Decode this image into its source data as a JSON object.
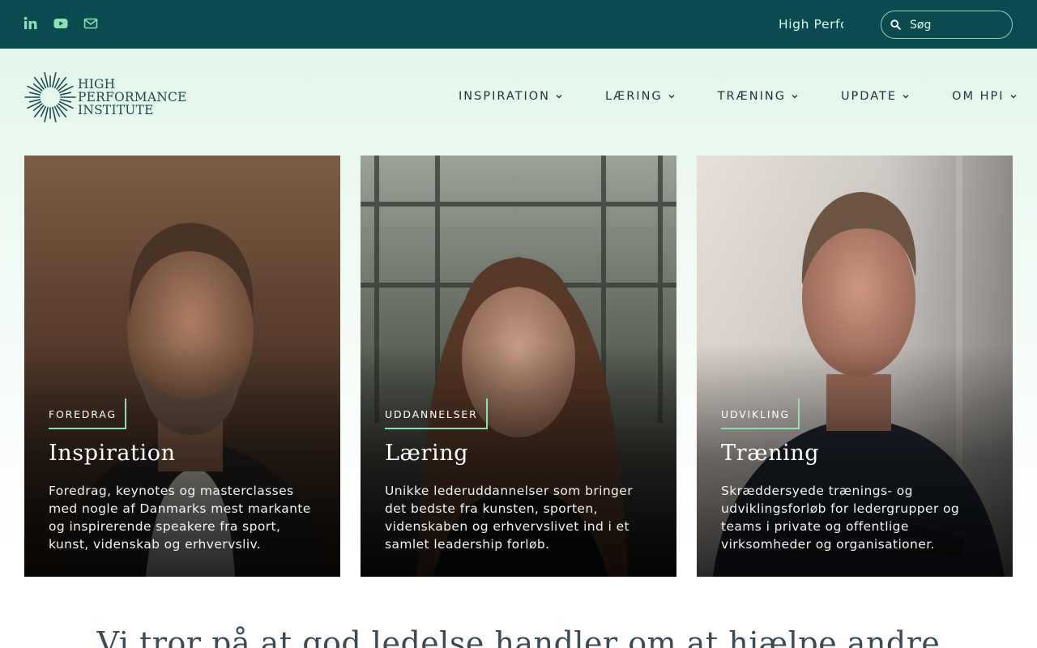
{
  "topbar": {
    "social": [
      {
        "icon": "linkedin-icon"
      },
      {
        "icon": "youtube-icon"
      },
      {
        "icon": "mail-icon"
      }
    ],
    "ticker_text": "High Perfo",
    "search": {
      "placeholder": "Søg"
    },
    "colors": {
      "background": "#0b4a50",
      "accent": "#8ee0b3"
    }
  },
  "header": {
    "logo": {
      "line1": "HIGH",
      "line2": "PERFORMANCE",
      "line3": "INSTITUTE"
    },
    "nav": [
      {
        "label": "INSPIRATION"
      },
      {
        "label": "LÆRING"
      },
      {
        "label": "TRÆNING"
      },
      {
        "label": "UPDATE"
      },
      {
        "label": "OM HPI"
      }
    ]
  },
  "cards": [
    {
      "tag": "FOREDRAG",
      "title": "Inspiration",
      "text": "Foredrag, keynotes og masterclasses med nogle af Danmarks mest markante og inspirerende speakere fra sport, kunst, videnskab og erhvervsliv."
    },
    {
      "tag": "UDDANNELSER",
      "title": "Læring",
      "text": "Unikke lederuddannelser som bringer det bedste fra kunsten, sporten, videnskaben og erhvervslivet ind i et samlet leadership forløb."
    },
    {
      "tag": "UDVIKLING",
      "title": "Træning",
      "text": "Skræddersyede trænings- og udviklingsforløb for ledergrupper og teams i private og offentlige virksomheder og organisationer."
    }
  ],
  "tagline": "Vi tror på at god ledelse handler om at hjælpe andre"
}
